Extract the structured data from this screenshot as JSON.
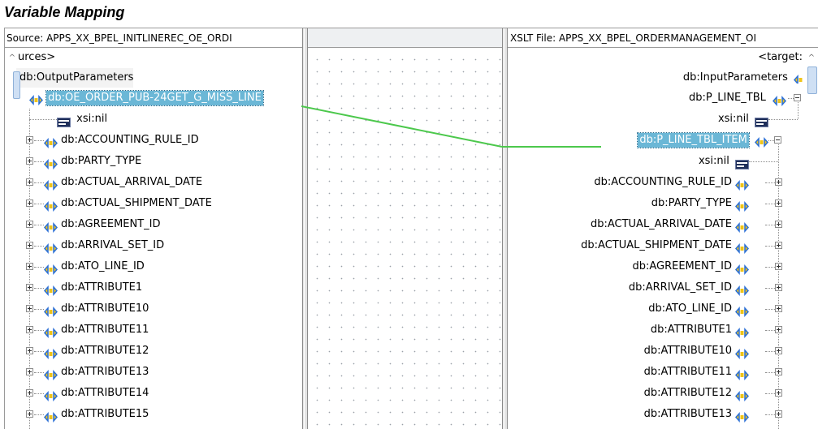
{
  "caption": "Variable Mapping",
  "source_pane": {
    "header": "Source: APPS_XX_BPEL_INITLINEREC_OE_ORDI",
    "root_label": "urces>",
    "params_label": "db:OutputParameters",
    "selected_label": "db:OE_ORDER_PUB-24GET_G_MISS_LINE",
    "nil_label": "xsi:nil",
    "items": [
      "db:ACCOUNTING_RULE_ID",
      "db:PARTY_TYPE",
      "db:ACTUAL_ARRIVAL_DATE",
      "db:ACTUAL_SHIPMENT_DATE",
      "db:AGREEMENT_ID",
      "db:ARRIVAL_SET_ID",
      "db:ATO_LINE_ID",
      "db:ATTRIBUTE1",
      "db:ATTRIBUTE10",
      "db:ATTRIBUTE11",
      "db:ATTRIBUTE12",
      "db:ATTRIBUTE13",
      "db:ATTRIBUTE14",
      "db:ATTRIBUTE15"
    ]
  },
  "target_pane": {
    "header": "XSLT File: APPS_XX_BPEL_ORDERMANAGEMENT_OI",
    "root_label": "<target:",
    "params_label": "db:InputParameters",
    "tbl_label": "db:P_LINE_TBL",
    "tbl_nil_label": "xsi:nil",
    "selected_label": "db:P_LINE_TBL_ITEM",
    "item_nil_label": "xsi:nil",
    "items": [
      "db:ACCOUNTING_RULE_ID",
      "db:PARTY_TYPE",
      "db:ACTUAL_ARRIVAL_DATE",
      "db:ACTUAL_SHIPMENT_DATE",
      "db:AGREEMENT_ID",
      "db:ARRIVAL_SET_ID",
      "db:ATO_LINE_ID",
      "db:ATTRIBUTE1",
      "db:ATTRIBUTE10",
      "db:ATTRIBUTE11",
      "db:ATTRIBUTE12",
      "db:ATTRIBUTE13"
    ]
  },
  "icons": {
    "element": "element-icon",
    "nil": "nil-attribute-icon",
    "expand": "plus-expander-icon",
    "collapse": "minus-expander-icon"
  },
  "colors": {
    "selection": "#6bb7d6",
    "link_line": "#4cc84c",
    "element_icon_blue": "#2a6fd6",
    "element_icon_yellow": "#f0c419"
  }
}
